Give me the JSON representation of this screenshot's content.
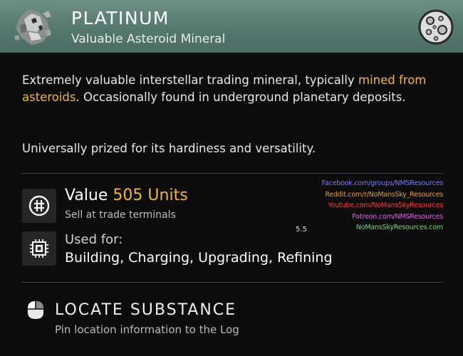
{
  "header": {
    "title": "PLATINUM",
    "subtitle": "Valuable Asteroid Mineral",
    "item_icon": "platinum-ore-icon",
    "class_icon": "asteroid-icon",
    "bg_color": "#5f8279"
  },
  "description": {
    "part1": "Extremely valuable interstellar trading mineral, typically ",
    "highlight": "mined from asteroids",
    "part2": ". Occasionally found in underground planetary deposits.",
    "paragraph2": "Universally prized for its hardiness and versatility.",
    "highlight_color": "#f3b733"
  },
  "value": {
    "label": "Value",
    "amount": "505 Units",
    "sub": "Sell at trade terminals",
    "icon": "units-currency-icon"
  },
  "used_for": {
    "label": "Used for:",
    "value": "Building, Charging, Upgrading, Refining",
    "icon": "chip-icon"
  },
  "links": [
    {
      "text": "Facebook.com/groups/NMSResources",
      "color": "#7b7bff"
    },
    {
      "text": "Reddit.com/r/NoMansSky_Resources",
      "color": "#f0a020"
    },
    {
      "text": "Youtube.com/NoMansSkyResources",
      "color": "#ff3a3a"
    },
    {
      "text": "Patreon.com/NMSResources",
      "color": "#d865e0"
    },
    {
      "text": "NoMansSkyResources.com",
      "color": "#6fe06f"
    }
  ],
  "version": "5.5",
  "locate": {
    "title": "LOCATE SUBSTANCE",
    "sub": "Pin location information to the Log",
    "icon": "mouse-icon"
  }
}
